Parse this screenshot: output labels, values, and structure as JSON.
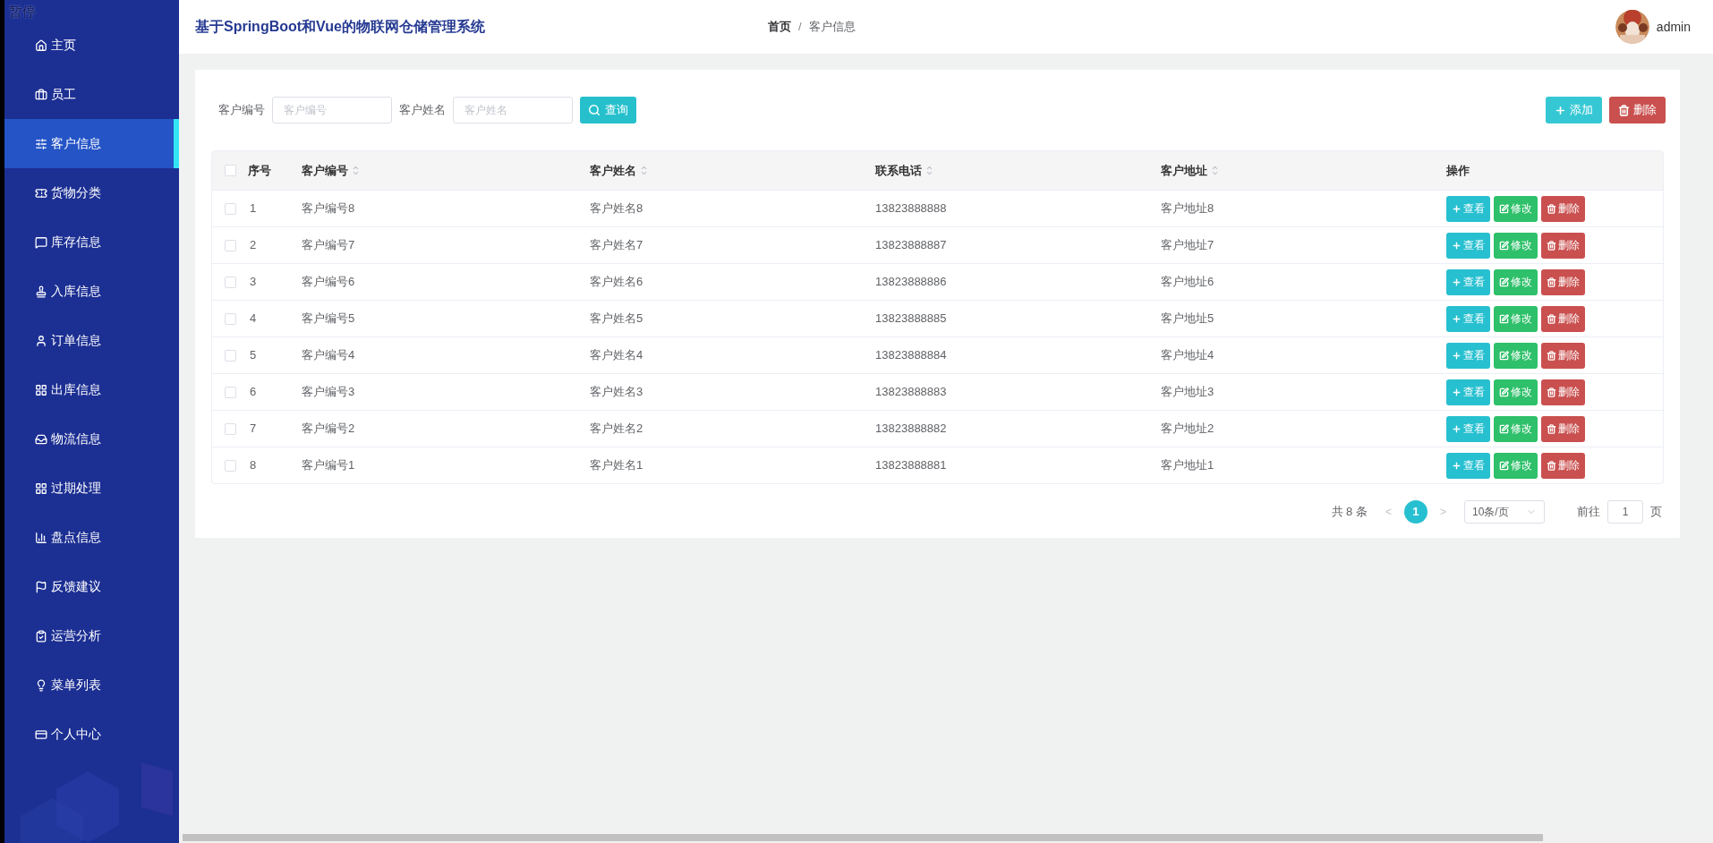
{
  "overlay_label": "暂停",
  "sidebar": {
    "items": [
      {
        "label": "主页",
        "selected": false
      },
      {
        "label": "员工",
        "selected": false
      },
      {
        "label": "客户信息",
        "selected": true
      },
      {
        "label": "货物分类",
        "selected": false
      },
      {
        "label": "库存信息",
        "selected": false
      },
      {
        "label": "入库信息",
        "selected": false
      },
      {
        "label": "订单信息",
        "selected": false
      },
      {
        "label": "出库信息",
        "selected": false
      },
      {
        "label": "物流信息",
        "selected": false
      },
      {
        "label": "过期处理",
        "selected": false
      },
      {
        "label": "盘点信息",
        "selected": false
      },
      {
        "label": "反馈建议",
        "selected": false
      },
      {
        "label": "运营分析",
        "selected": false
      },
      {
        "label": "菜单列表",
        "selected": false
      },
      {
        "label": "个人中心",
        "selected": false
      }
    ]
  },
  "header": {
    "title": "基于SpringBoot和Vue的物联网仓储管理系统",
    "breadcrumb": [
      "首页",
      "客户信息"
    ],
    "breadcrumb_separator": "/",
    "user": "admin"
  },
  "search": {
    "fields": [
      {
        "label": "客户编号",
        "placeholder": "客户编号"
      },
      {
        "label": "客户姓名",
        "placeholder": "客户姓名"
      }
    ],
    "button": "查询"
  },
  "actions": [
    {
      "label": "添加",
      "kind": "add"
    },
    {
      "label": "删除",
      "kind": "delete"
    }
  ],
  "table": {
    "all_checked": false,
    "columns": [
      {
        "label": "序号",
        "sortable": false
      },
      {
        "label": "客户编号",
        "sortable": true
      },
      {
        "label": "客户姓名",
        "sortable": true
      },
      {
        "label": "联系电话",
        "sortable": true
      },
      {
        "label": "客户地址",
        "sortable": true
      },
      {
        "label": "操作",
        "sortable": false
      }
    ],
    "rows": [
      {
        "checked": false,
        "cells": [
          "1",
          "客户编号8",
          "客户姓名8",
          "13823888888",
          "客户地址8"
        ],
        "actions": [
          "查看",
          "修改",
          "删除"
        ]
      },
      {
        "checked": false,
        "cells": [
          "2",
          "客户编号7",
          "客户姓名7",
          "13823888887",
          "客户地址7"
        ],
        "actions": [
          "查看",
          "修改",
          "删除"
        ]
      },
      {
        "checked": false,
        "cells": [
          "3",
          "客户编号6",
          "客户姓名6",
          "13823888886",
          "客户地址6"
        ],
        "actions": [
          "查看",
          "修改",
          "删除"
        ]
      },
      {
        "checked": false,
        "cells": [
          "4",
          "客户编号5",
          "客户姓名5",
          "13823888885",
          "客户地址5"
        ],
        "actions": [
          "查看",
          "修改",
          "删除"
        ]
      },
      {
        "checked": false,
        "cells": [
          "5",
          "客户编号4",
          "客户姓名4",
          "13823888884",
          "客户地址4"
        ],
        "actions": [
          "查看",
          "修改",
          "删除"
        ]
      },
      {
        "checked": false,
        "cells": [
          "6",
          "客户编号3",
          "客户姓名3",
          "13823888883",
          "客户地址3"
        ],
        "actions": [
          "查看",
          "修改",
          "删除"
        ]
      },
      {
        "checked": false,
        "cells": [
          "7",
          "客户编号2",
          "客户姓名2",
          "13823888882",
          "客户地址2"
        ],
        "actions": [
          "查看",
          "修改",
          "删除"
        ]
      },
      {
        "checked": false,
        "cells": [
          "8",
          "客户编号1",
          "客户姓名1",
          "13823888881",
          "客户地址1"
        ],
        "actions": [
          "查看",
          "修改",
          "删除"
        ]
      }
    ]
  },
  "pagination": {
    "total": "共 8 条",
    "prev": "<",
    "pages": [
      {
        "label": "1",
        "selected": true
      }
    ],
    "next": ">",
    "page_size": "10条/页",
    "goto_label": "前往",
    "goto_value": "1",
    "goto_suffix": "页"
  }
}
